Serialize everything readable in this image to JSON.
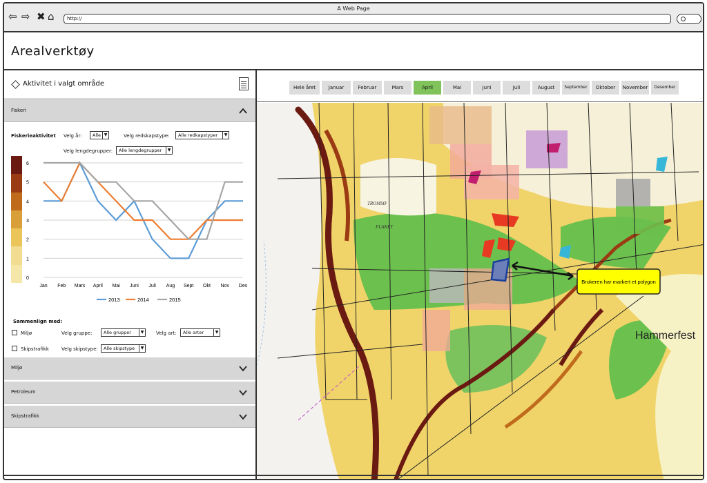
{
  "browser": {
    "title": "A Web Page",
    "url": "http://"
  },
  "app": {
    "title": "Arealverktøy"
  },
  "panel": {
    "title": "Aktivitet i valgt område"
  },
  "fiskeri": {
    "header": "Fiskeri",
    "heading": "Fiskerieaktivitet",
    "year_label": "Velg år:",
    "year_value": "Alle",
    "gear_label": "Velg redskapstype:",
    "gear_value": "Alle redkapstyper",
    "length_label": "Velg lengdegrupper:",
    "length_value": "Alle lengdegrupper"
  },
  "compare": {
    "heading": "Sammenlign med:",
    "opt1": "Miljø",
    "opt2": "Skipstrafikk",
    "group_label": "Velg gruppe:",
    "group_value": "Alle grupper",
    "species_label": "Velg art:",
    "species_value": "Alle arter",
    "shiptype_label": "Velg skipstype:",
    "shiptype_value": "Alle skipstype"
  },
  "sections": {
    "miljo": "Miljø",
    "petroleum": "Petroleum",
    "skipstrafikk": "Skipstrafikk"
  },
  "months": [
    "Hele året",
    "Januar",
    "Februar",
    "Mars",
    "April",
    "Mai",
    "Juni",
    "Juli",
    "August",
    "September",
    "Oktober",
    "November",
    "Desember"
  ],
  "active_month": "April",
  "map": {
    "callout": "Brukeren har markert et polygon",
    "place": "Hammerfest",
    "label_tromso": "TROMSØ",
    "label_flaket": "FLAKET"
  },
  "scale_colors": [
    "#6b1a12",
    "#9a3b14",
    "#c06a1c",
    "#d9a03a",
    "#ecc55a",
    "#f1dc92",
    "#f4e7a8"
  ],
  "chart_data": {
    "type": "line",
    "categories": [
      "Jan",
      "Feb",
      "Mars",
      "April",
      "Mai",
      "Juni",
      "Juli",
      "Aug",
      "Sept",
      "Okt",
      "Nov",
      "Des"
    ],
    "ylim": [
      0,
      6
    ],
    "yticks": [
      6,
      5,
      4,
      3,
      2,
      1,
      0
    ],
    "series": [
      {
        "name": "2013",
        "color": "#5b9bd5",
        "values": [
          4,
          4,
          6,
          4,
          3,
          4,
          2,
          1,
          1,
          3,
          4,
          4
        ]
      },
      {
        "name": "2014",
        "color": "#ed7d31",
        "values": [
          5,
          4,
          6,
          5,
          4,
          3,
          3,
          2,
          2,
          3,
          3,
          3
        ]
      },
      {
        "name": "2015",
        "color": "#a5a5a5",
        "values": [
          6,
          6,
          6,
          5,
          5,
          4,
          4,
          3,
          2,
          2,
          5,
          5
        ]
      }
    ]
  }
}
